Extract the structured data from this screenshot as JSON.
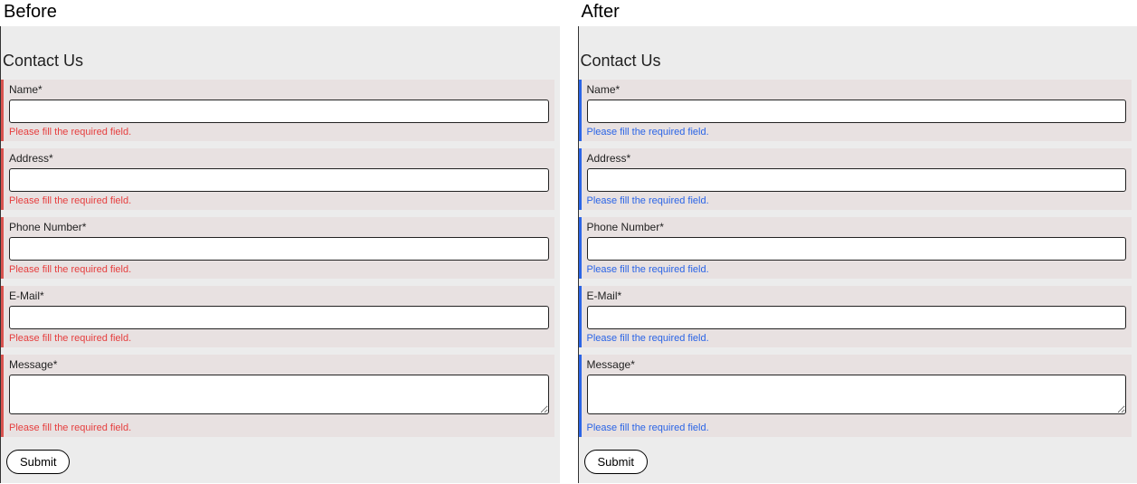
{
  "before": {
    "title": "Before",
    "form_title": "Contact Us",
    "fields": [
      {
        "label": "Name*",
        "error": "Please fill the required field.",
        "type": "input"
      },
      {
        "label": "Address*",
        "error": "Please fill the required field.",
        "type": "input"
      },
      {
        "label": "Phone Number*",
        "error": "Please fill the required field.",
        "type": "input"
      },
      {
        "label": "E-Mail*",
        "error": "Please fill the required field.",
        "type": "input"
      },
      {
        "label": "Message*",
        "error": "Please fill the required field.",
        "type": "textarea"
      }
    ],
    "submit": "Submit",
    "error_color": "#e63e3e",
    "accent_color": "#d9534f"
  },
  "after": {
    "title": "After",
    "form_title": "Contact Us",
    "fields": [
      {
        "label": "Name*",
        "error": "Please fill the required field.",
        "type": "input"
      },
      {
        "label": "Address*",
        "error": "Please fill the required field.",
        "type": "input"
      },
      {
        "label": "Phone Number*",
        "error": "Please fill the required field.",
        "type": "input"
      },
      {
        "label": "E-Mail*",
        "error": "Please fill the required field.",
        "type": "input"
      },
      {
        "label": "Message*",
        "error": "Please fill the required field.",
        "type": "textarea"
      }
    ],
    "submit": "Submit",
    "error_color": "#2a64e6",
    "accent_color": "#2a64e6"
  }
}
